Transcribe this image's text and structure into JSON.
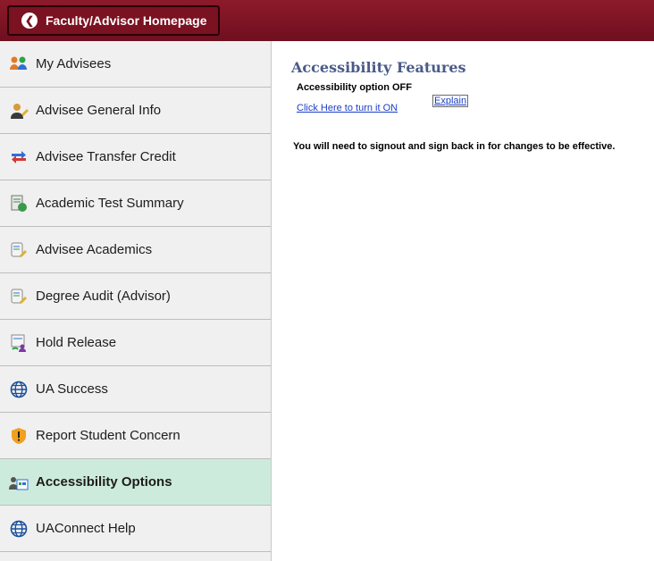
{
  "header": {
    "home_label": "Faculty/Advisor Homepage"
  },
  "sidebar": {
    "items": [
      {
        "label": "My Advisees",
        "icon": "people-icon"
      },
      {
        "label": "Advisee General Info",
        "icon": "person-pencil-icon"
      },
      {
        "label": "Advisee Transfer Credit",
        "icon": "transfer-arrows-icon"
      },
      {
        "label": "Academic Test Summary",
        "icon": "test-document-icon"
      },
      {
        "label": "Advisee Academics",
        "icon": "notepad-pencil-icon"
      },
      {
        "label": "Degree Audit (Advisor)",
        "icon": "notepad-pencil-icon"
      },
      {
        "label": "Hold Release",
        "icon": "hold-release-icon"
      },
      {
        "label": "UA Success",
        "icon": "globe-icon"
      },
      {
        "label": "Report Student Concern",
        "icon": "warning-shield-icon"
      },
      {
        "label": "Accessibility Options",
        "icon": "accessibility-icon",
        "active": true
      },
      {
        "label": "UAConnect Help",
        "icon": "globe-icon"
      }
    ]
  },
  "main": {
    "title": "Accessibility Features",
    "option_status": "Accessibility option OFF",
    "turn_on_link": "Click Here to turn it ON",
    "explain_link": "Explain",
    "notice": "You will need to signout and sign back in for changes to be effective."
  },
  "colors": {
    "header_bg": "#7a1222",
    "active_item_bg": "#cdebdc",
    "heading": "#4a5a89",
    "link": "#1a3ec7"
  }
}
